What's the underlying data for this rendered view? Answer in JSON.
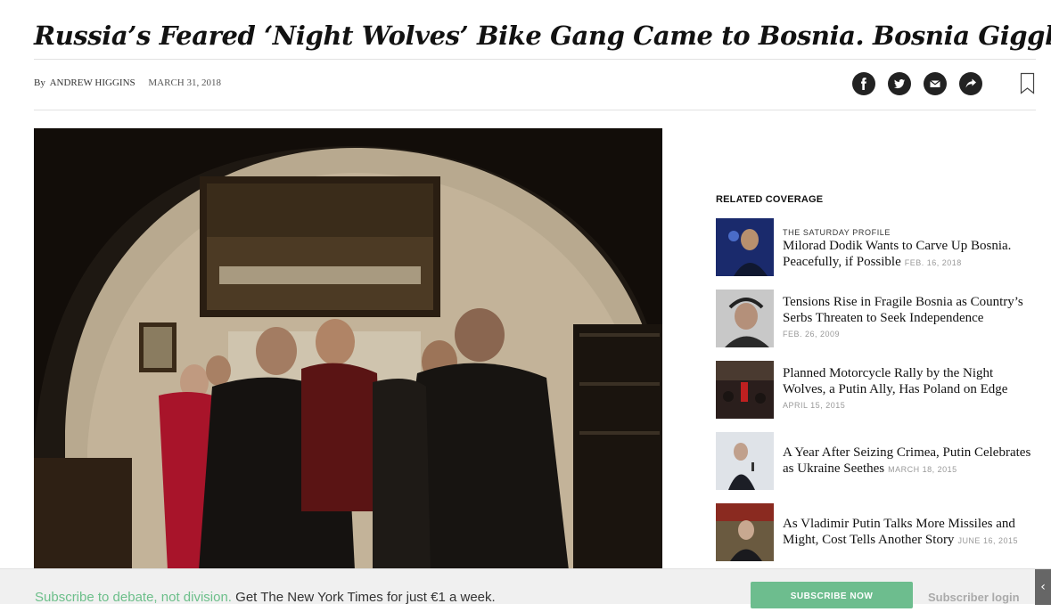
{
  "article": {
    "headline": "Russia’s Feared ‘Night Wolves’ Bike Gang Came to Bosnia. Bosnia Giggled.",
    "byline_prefix": "By",
    "author": "ANDREW HIGGINS",
    "date": "MARCH 31, 2018"
  },
  "share": {
    "icons": [
      "facebook-icon",
      "twitter-icon",
      "email-icon",
      "share-icon",
      "bookmark-icon"
    ]
  },
  "related": {
    "label": "RELATED COVERAGE",
    "items": [
      {
        "kicker": "THE SATURDAY PROFILE",
        "title": "Milorad Dodik Wants to Carve Up Bosnia. Peacefully, if Possible",
        "date": "FEB. 16, 2018"
      },
      {
        "title": "Tensions Rise in Fragile Bosnia as Country’s Serbs Threaten to Seek Independence",
        "date": "FEB. 26, 2009"
      },
      {
        "title": "Planned Motorcycle Rally by the Night Wolves, a Putin Ally, Has Poland on Edge",
        "date": "APRIL 15, 2015"
      },
      {
        "title": "A Year After Seizing Crimea, Putin Celebrates as Ukraine Seethes",
        "date": "MARCH 18, 2015"
      },
      {
        "title": "As Vladimir Putin Talks More Missiles and Might, Cost Tells Another Story",
        "date": "JUNE 16, 2015"
      }
    ]
  },
  "banner": {
    "promo_green": "Subscribe to debate, not division.",
    "promo_rest": " Get The New York Times for just €1 a week.",
    "subscribe_label": "SUBSCRIBE NOW",
    "login_label": "Subscriber login",
    "collapse_glyph": "‹"
  },
  "colors": {
    "accent_green": "#6dbd8e",
    "icon_dark": "#222222"
  }
}
